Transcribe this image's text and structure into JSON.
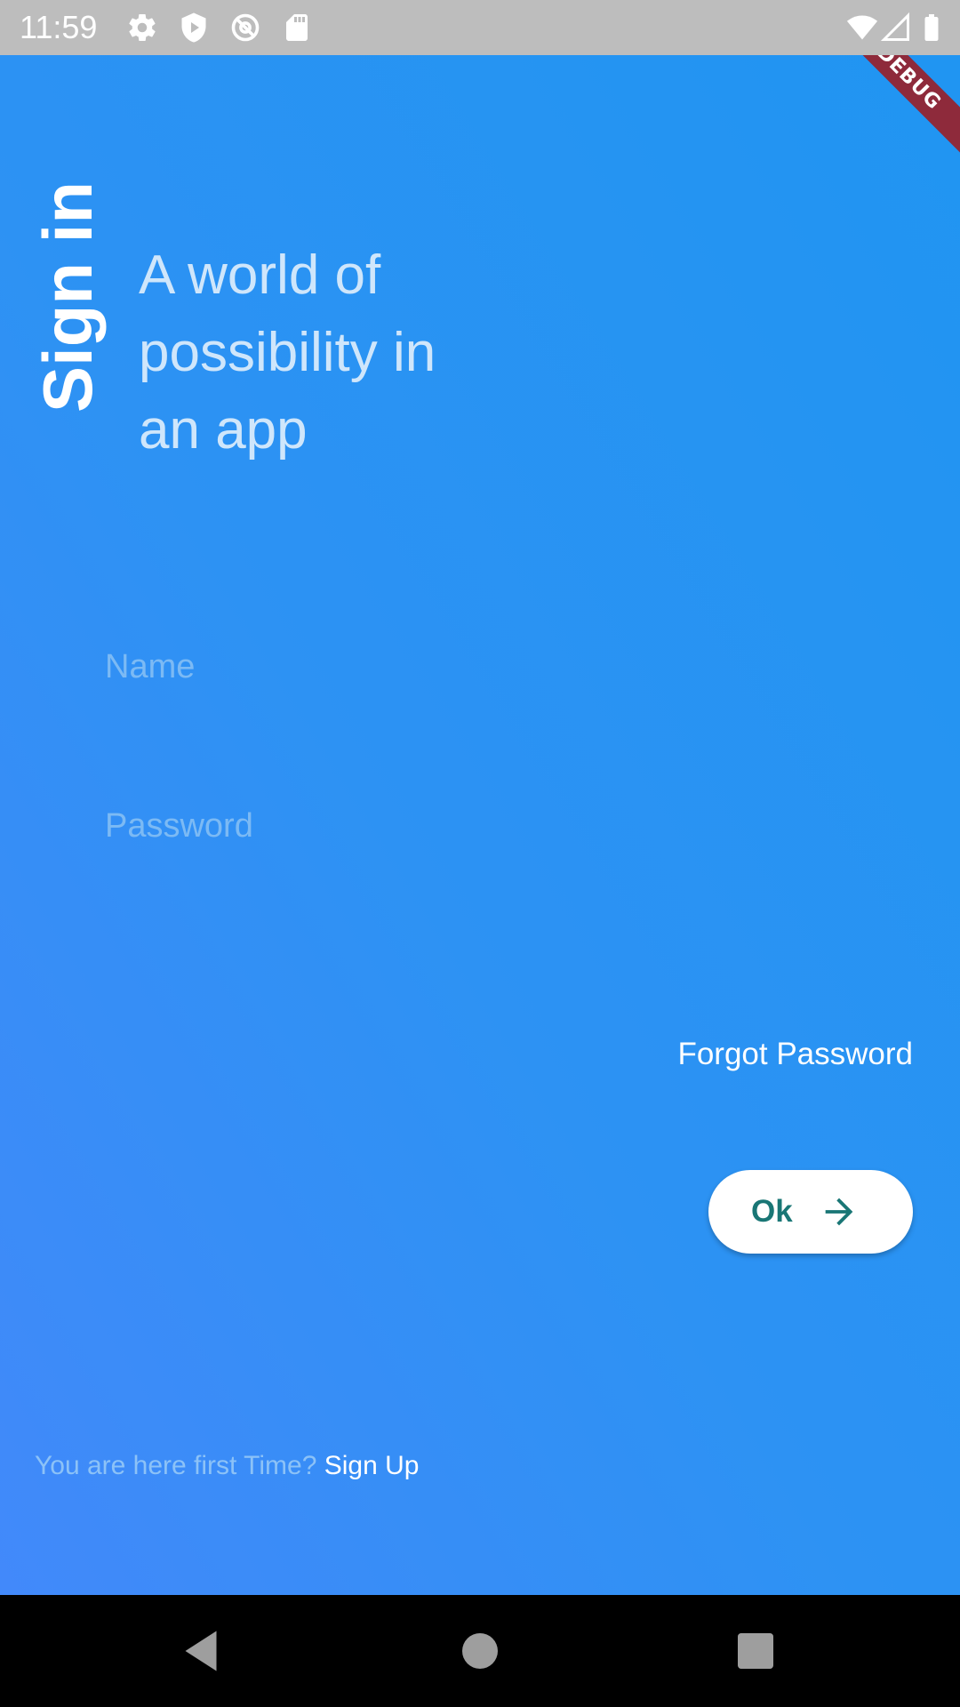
{
  "status_bar": {
    "time": "11:59",
    "left_icons": [
      "gear-icon",
      "shield-play-icon",
      "at-sign-icon",
      "sd-card-icon"
    ],
    "right_icons": [
      "wifi-icon",
      "cell-signal-icon",
      "battery-icon"
    ]
  },
  "debug_banner": "DEBUG",
  "header": {
    "vertical_title": "Sign in",
    "tagline": "A world of possibility in an app"
  },
  "form": {
    "name_placeholder": "Name",
    "name_value": "",
    "password_placeholder": "Password",
    "password_value": ""
  },
  "forgot_password": "Forgot Password",
  "ok_button": {
    "label": "Ok",
    "icon": "arrow-right-icon"
  },
  "signup": {
    "prompt": "You are here first Time?",
    "link": "Sign Up"
  },
  "nav_bar": {
    "icons": [
      "back-triangle-icon",
      "home-circle-icon",
      "recents-square-icon"
    ]
  },
  "colors": {
    "status_bar": "#bdbdbd",
    "gradient_start": "#4289fa",
    "gradient_end": "#2095f2",
    "accent_text": "#197675",
    "debug_banner": "#8e2a3b",
    "placeholder": "#7cbaf4"
  }
}
